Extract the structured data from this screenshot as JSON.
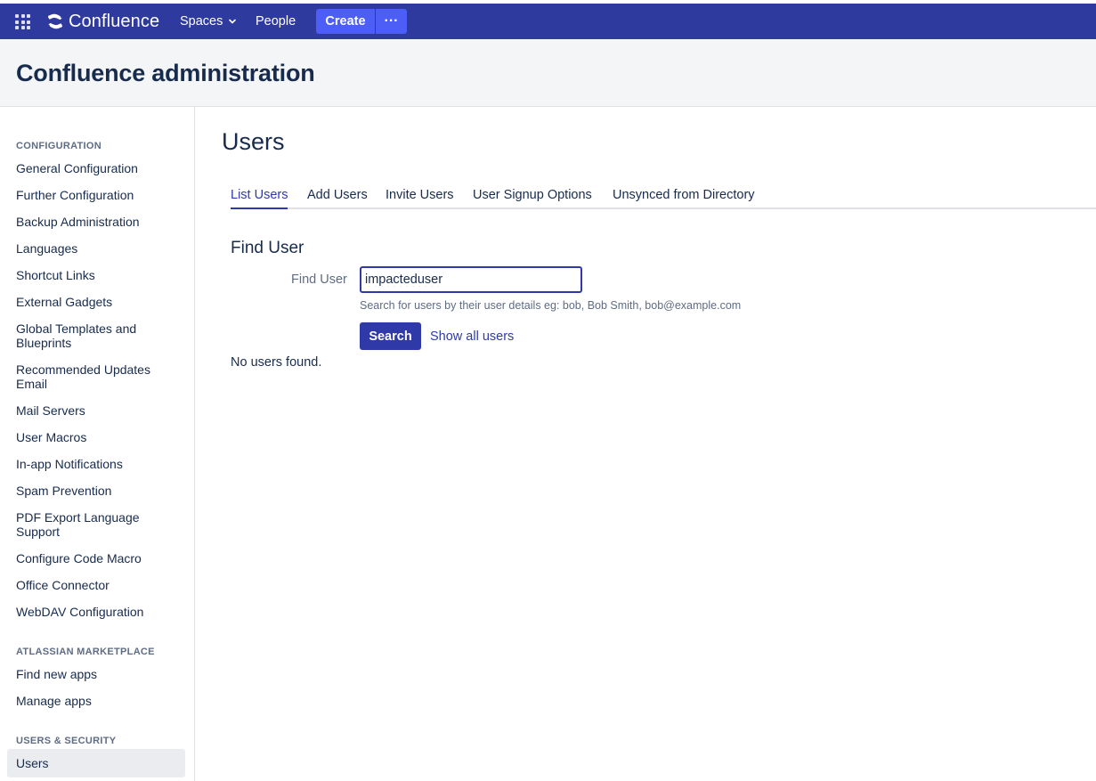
{
  "header": {
    "app_name": "Confluence",
    "nav": {
      "spaces_label": "Spaces",
      "people_label": "People"
    },
    "create_label": "Create",
    "more_label": "···",
    "colors": {
      "header_bg": "#2f3a9f",
      "create_bg": "#4c5ef5"
    }
  },
  "admin": {
    "title": "Confluence administration"
  },
  "sidebar": {
    "sections": [
      {
        "heading": "CONFIGURATION"
      },
      {
        "heading": "ATLASSIAN MARKETPLACE"
      },
      {
        "heading": "USERS & SECURITY"
      }
    ],
    "items": [
      {
        "label": "General Configuration"
      },
      {
        "label": "Further Configuration"
      },
      {
        "label": "Backup Administration"
      },
      {
        "label": "Languages"
      },
      {
        "label": "Shortcut Links"
      },
      {
        "label": "External Gadgets"
      },
      {
        "label": "Global Templates and Blueprints"
      },
      {
        "label": "Recommended Updates Email"
      },
      {
        "label": "Mail Servers"
      },
      {
        "label": "User Macros"
      },
      {
        "label": "In-app Notifications"
      },
      {
        "label": "Spam Prevention"
      },
      {
        "label": "PDF Export Language Support"
      },
      {
        "label": "Configure Code Macro"
      },
      {
        "label": "Office Connector"
      },
      {
        "label": "WebDAV Configuration"
      },
      {
        "label": "Find new apps"
      },
      {
        "label": "Manage apps"
      },
      {
        "label": "Users",
        "active": true
      }
    ]
  },
  "main": {
    "title": "Users",
    "tabs": [
      {
        "label": "List Users",
        "active": true
      },
      {
        "label": "Add Users"
      },
      {
        "label": "Invite Users"
      },
      {
        "label": "User Signup Options"
      },
      {
        "label": "Unsynced from Directory"
      }
    ],
    "find_user": {
      "section_title": "Find User",
      "field_label": "Find User",
      "input_value": "impacteduser",
      "help_text": "Search for users by their user details eg: bob, Bob Smith, bob@example.com",
      "search_label": "Search",
      "show_all_label": "Show all users",
      "result_text": "No users found."
    },
    "colors": {
      "accent": "#2f3aa8"
    }
  }
}
